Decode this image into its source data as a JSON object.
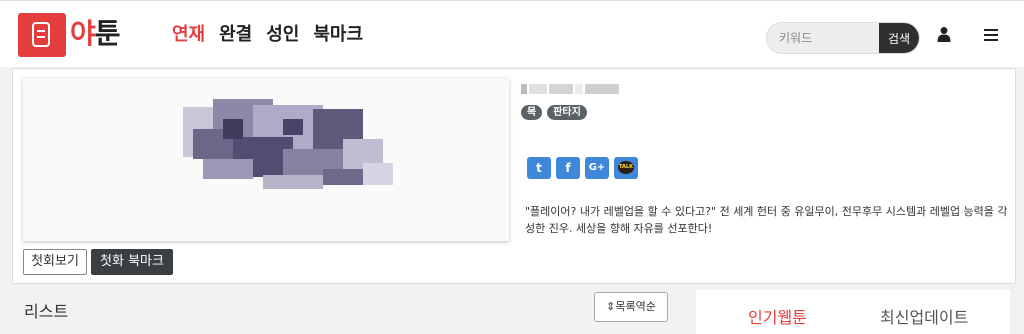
{
  "brand": {
    "logo_part1": "야",
    "logo_part2": "툰",
    "accent_color": "#e43d3d",
    "logo_icon": "book-icon"
  },
  "nav": [
    {
      "label": "연재",
      "active": true
    },
    {
      "label": "완결",
      "active": false
    },
    {
      "label": "성인",
      "active": false
    },
    {
      "label": "북마크",
      "active": false
    }
  ],
  "search": {
    "placeholder": "키워드",
    "button_label": "검색"
  },
  "header_icons": [
    "user-icon",
    "menu-icon"
  ],
  "series": {
    "badges": [
      "목",
      "판타지"
    ],
    "share_buttons": [
      {
        "name": "twitter-icon",
        "glyph": "t"
      },
      {
        "name": "facebook-icon",
        "glyph": "f"
      },
      {
        "name": "google-plus-icon",
        "glyph": "G+"
      },
      {
        "name": "kakaotalk-icon",
        "glyph": "TALK"
      }
    ],
    "description": "\"플레이어? 내가 레벨업을 할 수 있다고?\" 전 세계 헌터 중 유일무이, 전무후무 시스템과 레벨업 능력을 각성한 진우. 세상을 향해 자유를 선포한다!",
    "first_view_label": "첫회보기",
    "bookmark_label": "첫화 북마크"
  },
  "list": {
    "label": "리스트",
    "sort_label": "목록역순"
  },
  "side_tabs": {
    "popular": "인기웹툰",
    "latest": "최신업데이트"
  }
}
